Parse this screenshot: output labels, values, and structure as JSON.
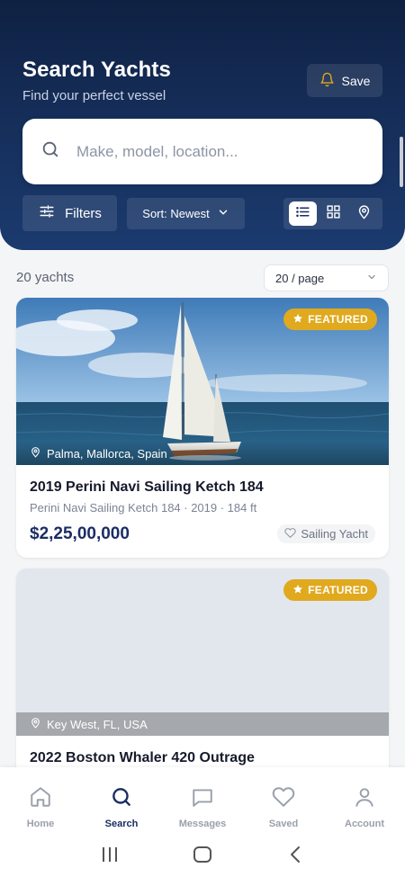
{
  "header": {
    "title": "Search Yachts",
    "subtitle": "Find your perfect vessel",
    "save_label": "Save"
  },
  "search": {
    "placeholder": "Make, model, location..."
  },
  "toolbar": {
    "filters_label": "Filters",
    "sort_label": "Sort: Newest",
    "view_modes": [
      "list",
      "grid",
      "map"
    ],
    "active_view": "list"
  },
  "results": {
    "count_label": "20 yachts",
    "per_page": "20 / page"
  },
  "listings": [
    {
      "badge": "FEATURED",
      "location": "Palma, Mallorca, Spain",
      "name": "2019 Perini Navi Sailing Ketch 184",
      "meta": "Perini Navi Sailing Ketch 184 · 2019 · 184 ft",
      "price": "$2,25,00,000",
      "type": "Sailing Yacht",
      "has_photo": true
    },
    {
      "badge": "FEATURED",
      "location": "Key West, FL, USA",
      "name": "2022 Boston Whaler 420 Outrage",
      "has_photo": false
    }
  ],
  "bottom_nav": {
    "items": [
      {
        "label": "Home",
        "icon": "home-icon"
      },
      {
        "label": "Search",
        "icon": "search-icon"
      },
      {
        "label": "Messages",
        "icon": "message-icon"
      },
      {
        "label": "Saved",
        "icon": "heart-icon"
      },
      {
        "label": "Account",
        "icon": "user-icon"
      }
    ],
    "active": "Search"
  },
  "colors": {
    "header_bg": "#16305d",
    "accent": "#1a2d64",
    "badge": "#e0a91e",
    "page_bg": "#f4f5f7"
  }
}
